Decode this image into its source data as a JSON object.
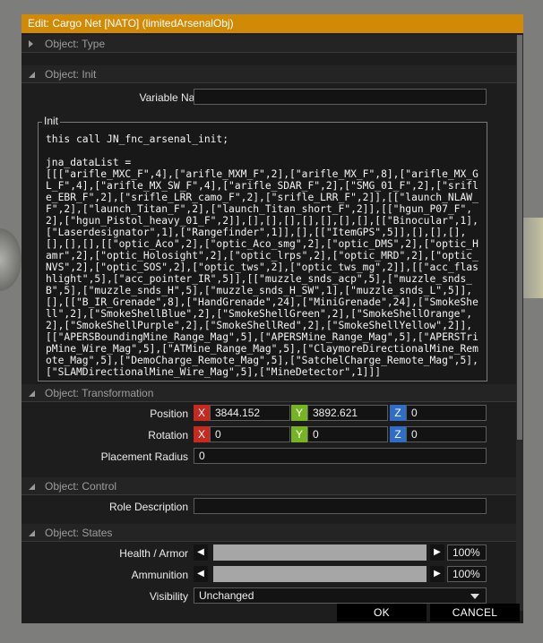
{
  "window": {
    "title": "Edit: Cargo Net [NATO] (limitedArsenalObj)"
  },
  "sections": {
    "type": {
      "title": "Object: Type"
    },
    "init": {
      "title": "Object: Init",
      "variable_name_label": "Variable Name",
      "variable_name_value": "",
      "init_label": "Init",
      "init_code": "this call JN_fnc_arsenal_init;\n\njna_dataList =\n[[[\"arifle_MXC_F\",4],[\"arifle_MXM_F\",2],[\"arifle_MX_F\",8],[\"arifle_MX_GL_F\",4],[\"arifle_MX_SW_F\",4],[\"arifle_SDAR_F\",2],[\"SMG_01_F\",2],[\"srifle_EBR_F\",2],[\"srifle_LRR_camo_F\",2],[\"srifle_LRR_F\",2]],[[\"launch_NLAW_F\",2],[\"launch_Titan_F\",2],[\"launch_Titan_short_F\",2]],[[\"hgun_P07_F\",2],[\"hgun_Pistol_heavy_01_F\",2]],[],[],[],[],[],[],[],[[\"Binocular\",1],[\"Laserdesignator\",1],[\"Rangefinder\",1]],[],[[\"ItemGPS\",5]],[],[],[],[],[],[],[[\"optic_Aco\",2],[\"optic_Aco_smg\",2],[\"optic_DMS\",2],[\"optic_Hamr\",2],[\"optic_Holosight\",2],[\"optic_lrps\",2],[\"optic_MRD\",2],[\"optic_NVS\",2],[\"optic_SOS\",2],[\"optic_tws\",2],[\"optic_tws_mg\",2]],[[\"acc_flashlight\",5],[\"acc_pointer_IR\",5]],[[\"muzzle_snds_acp\",5],[\"muzzle_snds_B\",5],[\"muzzle_snds_H\",5],[\"muzzle_snds_H_SW\",1],[\"muzzle_snds_L\",5]],[],[[\"B_IR_Grenade\",8],[\"HandGrenade\",24],[\"MiniGrenade\",24],[\"SmokeShell\",2],[\"SmokeShellBlue\",2],[\"SmokeShellGreen\",2],[\"SmokeShellOrange\",2],[\"SmokeShellPurple\",2],[\"SmokeShellRed\",2],[\"SmokeShellYellow\",2]],[[\"APERSBoundingMine_Range_Mag\",5],[\"APERSMine_Range_Mag\",5],[\"APERSTripMine_Wire_Mag\",5],[\"ATMine_Range_Mag\",5],[\"ClaymoreDirectionalMine_Remote_Mag\",5],[\"DemoCharge_Remote_Mag\",5],[\"SatchelCharge_Remote_Mag\",5],[\"SLAMDirectionalMine_Wire_Mag\",5],[\"MineDetector\",1]]]"
    },
    "transformation": {
      "title": "Object: Transformation",
      "position_label": "Position",
      "rotation_label": "Rotation",
      "placement_radius_label": "Placement Radius",
      "axis_x": "X",
      "axis_y": "Y",
      "axis_z": "Z",
      "position": {
        "x": "3844.152",
        "y": "3892.621",
        "z": "0"
      },
      "rotation": {
        "x": "0",
        "y": "0",
        "z": "0"
      },
      "placement_radius": "0"
    },
    "control": {
      "title": "Object: Control",
      "role_description_label": "Role Description",
      "role_description_value": ""
    },
    "states": {
      "title": "Object: States",
      "health_label": "Health / Armor",
      "health_value": "100%",
      "health_level": 1.0,
      "ammo_label": "Ammunition",
      "ammo_value": "100%",
      "ammo_level": 1.0,
      "visibility_label": "Visibility",
      "visibility_value": "Unchanged"
    }
  },
  "buttons": {
    "ok": "OK",
    "cancel": "CANCEL"
  },
  "colors": {
    "title_bar": "#d08a06",
    "axis_x": "#c42a1f",
    "axis_y": "#76b521",
    "axis_z": "#2f6dc7"
  },
  "icons": {
    "collapsed": "triangle-right-icon",
    "expanded": "triangle-down-icon",
    "slider_left": "arrow-left-icon",
    "slider_right": "arrow-right-icon",
    "combo": "chevron-down-icon"
  }
}
